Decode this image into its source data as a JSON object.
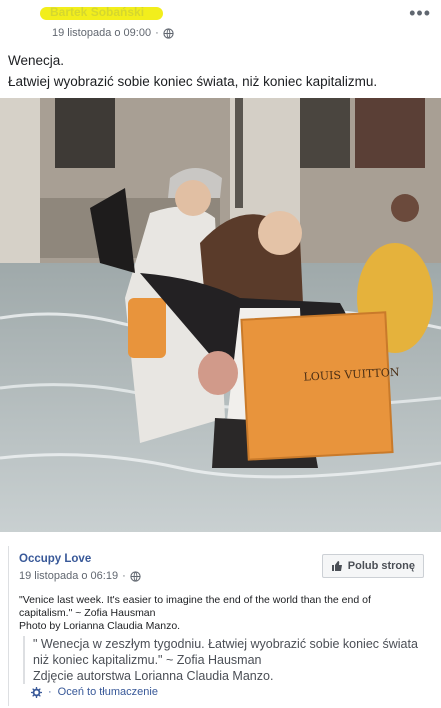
{
  "post": {
    "author_redacted": "Bartek Sobański",
    "timestamp": "19 listopada o 09:00",
    "audience_icon": "globe-icon",
    "menu_icon": "more-dots-icon",
    "text_lines": [
      "Wenecja.",
      "Łatwiej wyobrazić sobie koniec świata, niż koniec kapitalizmu."
    ],
    "photo": {
      "bag_text": "LOUIS VUITTON"
    }
  },
  "shared": {
    "page_name": "Occupy Love",
    "timestamp": "19 listopada o 06:19",
    "audience_icon": "globe-icon",
    "like_button": "Polub stronę",
    "like_icon": "thumbs-up-icon",
    "quote_line1": "\"Venice last week. It's easier to imagine the end of the world than the end of",
    "quote_line2": "capitalism.\" ~ Zofia Hausman",
    "credit": "Photo by Lorianna Claudia Manzo.",
    "translation_line1": "\" Wenecja w zeszłym tygodniu. Łatwiej wyobrazić sobie koniec świata",
    "translation_line2": "niż koniec kapitalizmu.\" ~ Zofia Hausman",
    "translation_credit": "Zdjęcie autorstwa Lorianna Claudia Manzo.",
    "rate_translation": "Oceń to tłumaczenie",
    "rate_icon": "gear-icon"
  },
  "colors": {
    "link_blue": "#385898",
    "highlight_yellow": "#f2ee1c",
    "bag_orange": "#e8943c",
    "water": "#b8c2c3"
  }
}
